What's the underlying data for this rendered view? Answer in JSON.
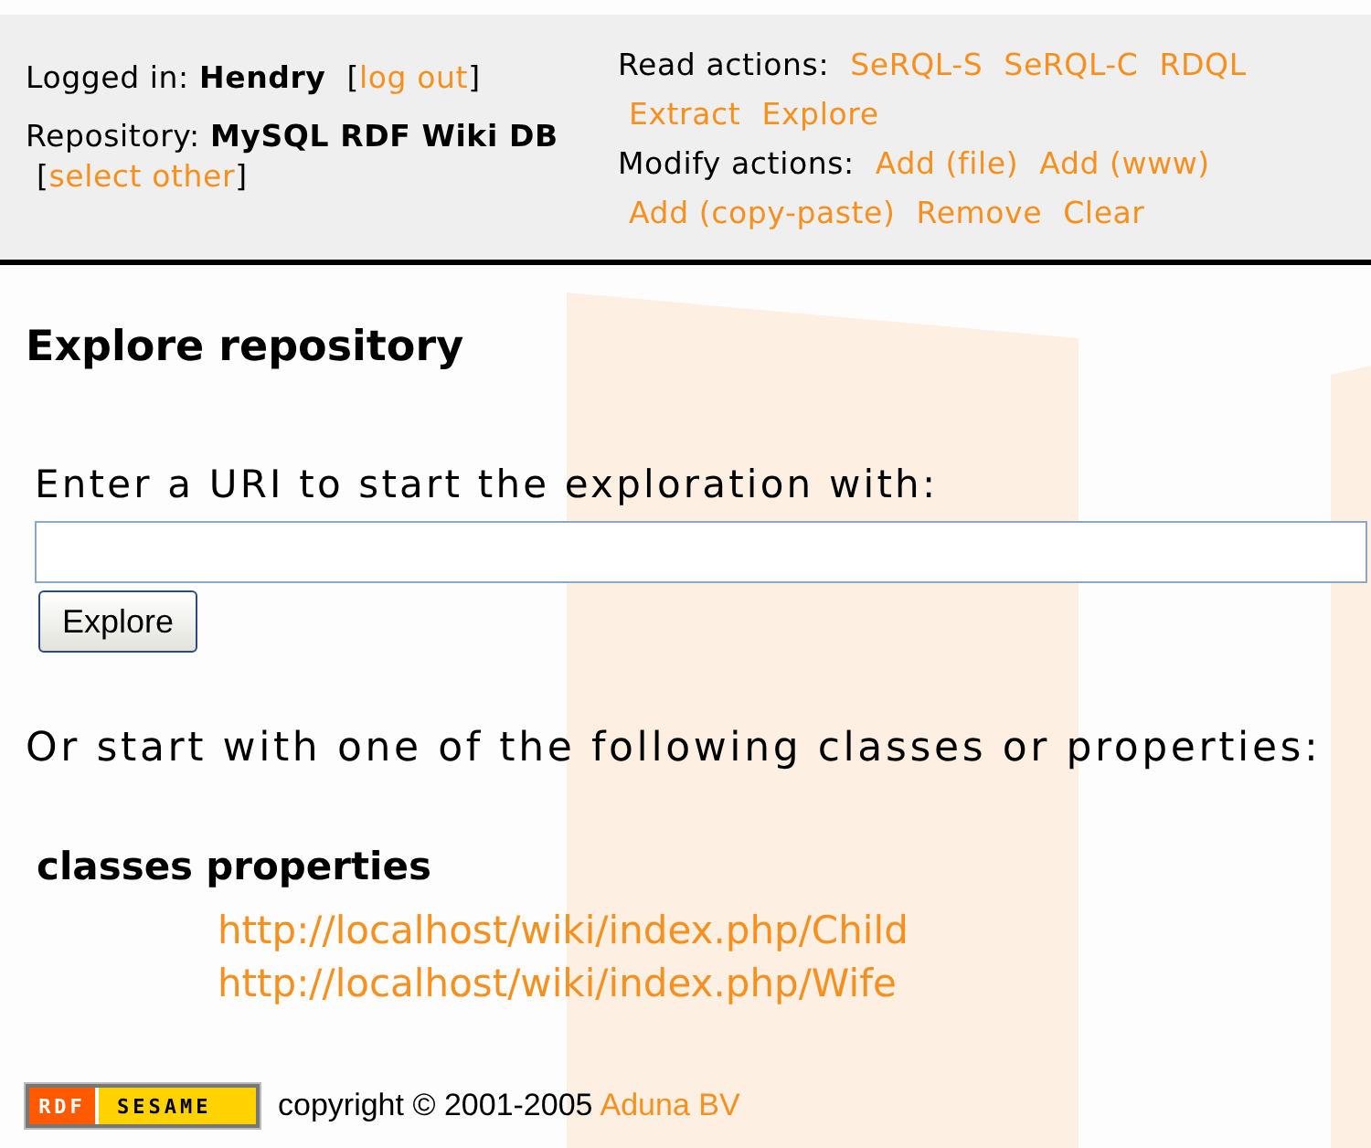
{
  "header": {
    "login": {
      "label": "Logged in:",
      "value": "Hendry",
      "open": "[",
      "link": "log out",
      "close": "]"
    },
    "repository": {
      "label": "Repository:",
      "value": "MySQL RDF Wiki DB",
      "open": "[",
      "link": "select other",
      "close": "]"
    },
    "action_groups": [
      {
        "label": "Read actions:",
        "links": [
          "SeRQL-S",
          "SeRQL-C",
          "RDQL",
          "Extract",
          "Explore"
        ]
      },
      {
        "label": "Modify actions:",
        "links": [
          "Add (file)",
          "Add (www)",
          "Add (copy-paste)",
          "Remove",
          "Clear"
        ]
      }
    ]
  },
  "main": {
    "title": "Explore repository",
    "field_label": "Enter a URI to start the exploration with:",
    "button": "Explore",
    "prompt": "Or start with one of the following classes or properties:",
    "headings": [
      "classes",
      "properties"
    ],
    "links": [
      "http://localhost/wiki/index.php/Child",
      "http://localhost/wiki/index.php/Wife"
    ]
  },
  "footer": {
    "logo": [
      "RDF",
      "SESAME"
    ],
    "copyright": "copyright © 2001-2005",
    "link": "Aduna BV"
  }
}
